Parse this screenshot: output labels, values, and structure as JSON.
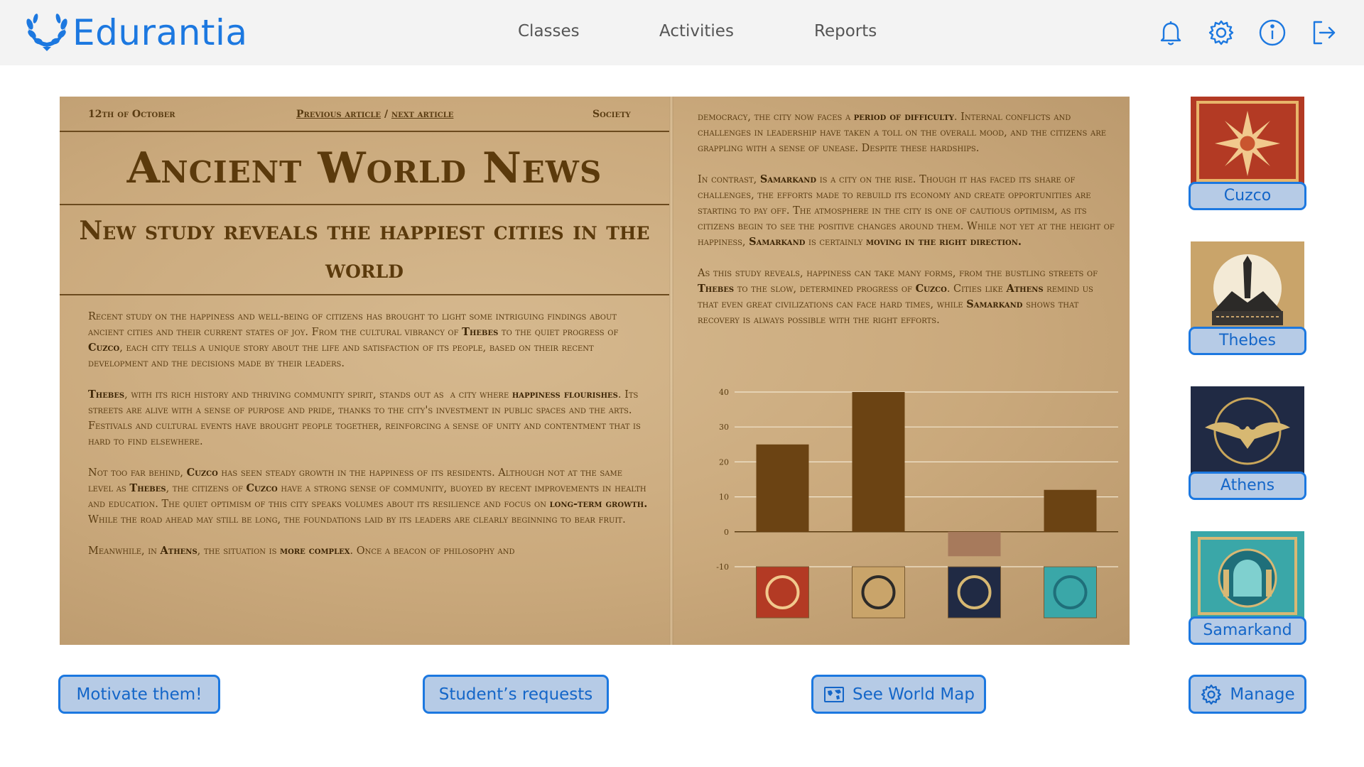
{
  "app": {
    "name": "Edurantia"
  },
  "nav": {
    "items": [
      "Classes",
      "Activities",
      "Reports"
    ]
  },
  "toolbar_icons": [
    "bell-icon",
    "gear-icon",
    "info-icon",
    "logout-icon"
  ],
  "article": {
    "date": "12th of October",
    "prev_link": "Previous article",
    "separator": "/",
    "next_link": "next article",
    "section": "Society",
    "masthead": "Ancient World News",
    "headline": "New study reveals the happiest cities in the world"
  },
  "cities": [
    {
      "name": "Cuzco"
    },
    {
      "name": "Thebes"
    },
    {
      "name": "Athens"
    },
    {
      "name": "Samarkand"
    }
  ],
  "chart_data": {
    "type": "bar",
    "categories": [
      "Cuzco",
      "Thebes",
      "Athens",
      "Samarkand"
    ],
    "values": [
      25,
      40,
      -7,
      12
    ],
    "ylim": [
      -10,
      40
    ],
    "yticks": [
      -10,
      0,
      10,
      20,
      30,
      40
    ],
    "grid": true,
    "x_tick_labels": "city emblem images",
    "colors": {
      "positive": "#6b4313",
      "negative": "#a77a5c"
    }
  },
  "buttons": {
    "motivate": "Motivate them!",
    "requests": "Student’s requests",
    "world_map": "See World Map",
    "manage": "Manage"
  },
  "colors": {
    "brand": "#1c78e0",
    "button_fill": "#b6cbe6",
    "paper": "#caa97c",
    "ink": "#5a3c12"
  }
}
